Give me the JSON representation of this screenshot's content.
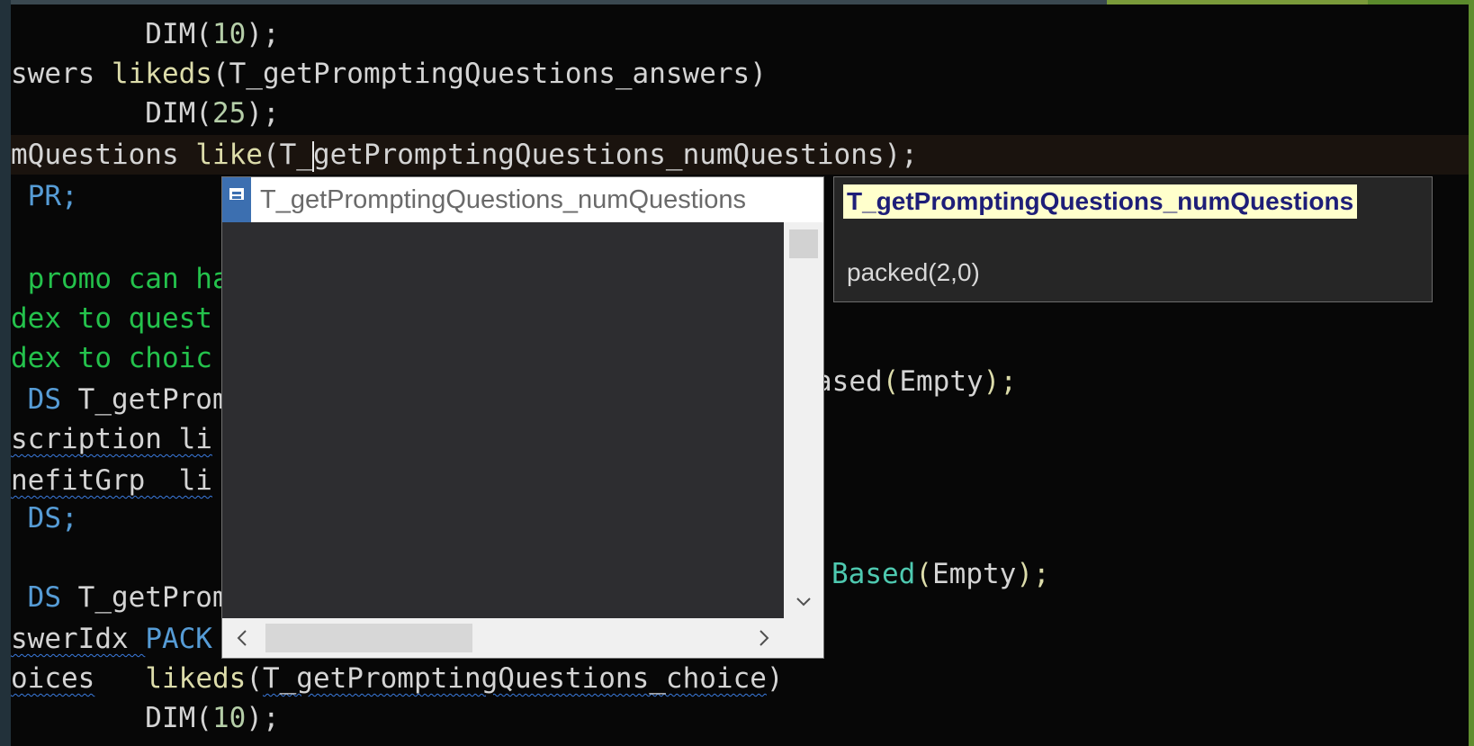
{
  "editor": {
    "lines": [
      {
        "id": "l0",
        "segments": [
          {
            "text": "        DIM(",
            "cls": ""
          },
          {
            "text": "10",
            "cls": "num"
          },
          {
            "text": ");",
            "cls": ""
          }
        ]
      },
      {
        "id": "l1",
        "segments": [
          {
            "text": "swers ",
            "cls": ""
          },
          {
            "text": "likeds",
            "cls": "fn"
          },
          {
            "text": "(T_getPromptingQuestions_answers)",
            "cls": ""
          }
        ]
      },
      {
        "id": "l2",
        "segments": [
          {
            "text": "        DIM(",
            "cls": ""
          },
          {
            "text": "25",
            "cls": "num"
          },
          {
            "text": ");",
            "cls": ""
          }
        ]
      },
      {
        "id": "l3",
        "segments": [
          {
            "text": "mQuestions ",
            "cls": ""
          },
          {
            "text": "like",
            "cls": "fn"
          },
          {
            "text": "(T_",
            "cls": ""
          },
          {
            "text": "",
            "cls": "caret"
          },
          {
            "text": "getPromptingQuestions_numQuestions);",
            "cls": ""
          }
        ]
      },
      {
        "id": "l4",
        "segments": [
          {
            "text": " PR;",
            "cls": "kw"
          }
        ]
      },
      {
        "id": "l5",
        "segments": [
          {
            "text": "",
            "cls": ""
          }
        ]
      },
      {
        "id": "l6",
        "segments": [
          {
            "text": " promo can ha",
            "cls": "cm"
          }
        ]
      },
      {
        "id": "l7",
        "segments": [
          {
            "text": "dex to quest",
            "cls": "cm"
          }
        ]
      },
      {
        "id": "l8",
        "segments": [
          {
            "text": "dex to choic",
            "cls": "cm"
          }
        ]
      },
      {
        "id": "l9",
        "segments": [
          {
            "text": " DS ",
            "cls": "kw"
          },
          {
            "text": "T_getProm",
            "cls": ""
          }
        ]
      },
      {
        "id": "l10",
        "segments": [
          {
            "text": "scription li",
            "cls": "sq"
          }
        ]
      },
      {
        "id": "l11",
        "segments": [
          {
            "text": "nefitGrp  li",
            "cls": "sq"
          }
        ]
      },
      {
        "id": "l12",
        "segments": [
          {
            "text": " DS;",
            "cls": "kw"
          }
        ]
      },
      {
        "id": "l13",
        "segments": [
          {
            "text": "",
            "cls": ""
          }
        ]
      },
      {
        "id": "l14",
        "segments": [
          {
            "text": " DS ",
            "cls": "kw"
          },
          {
            "text": "T_getProm",
            "cls": ""
          }
        ]
      },
      {
        "id": "l15",
        "segments": [
          {
            "text": "swerIdx ",
            "cls": "sq"
          },
          {
            "text": "PACK",
            "cls": "kw"
          }
        ]
      },
      {
        "id": "l16",
        "segments": [
          {
            "text": "oices",
            "cls": "sq"
          },
          {
            "text": "   ",
            "cls": ""
          },
          {
            "text": "likeds",
            "cls": "fn"
          },
          {
            "text": "(",
            "cls": ""
          },
          {
            "text": "T_getPromptingQuestions_choice",
            "cls": "sq"
          },
          {
            "text": ")",
            "cls": ""
          }
        ]
      },
      {
        "id": "l17",
        "segments": [
          {
            "text": "        DIM(",
            "cls": ""
          },
          {
            "text": "10",
            "cls": "num"
          },
          {
            "text": ");",
            "cls": ""
          }
        ]
      }
    ],
    "right_fragments": {
      "line9": {
        "prefix": "ased",
        "paren_open": "(",
        "inner": "Empty",
        "paren_close": ");"
      },
      "line14": {
        "prefix": "Based",
        "paren_open": "(",
        "inner": "Empty",
        "paren_close": ");"
      }
    }
  },
  "autocomplete": {
    "item_label": "T_getPromptingQuestions_numQuestions",
    "item_icon": "field-icon",
    "scroll_down_glyph": "⌄",
    "scroll_left_glyph": "<",
    "scroll_right_glyph": ">"
  },
  "tooltip": {
    "name": "T_getPromptingQuestions_numQuestions",
    "type": "packed(2,0)"
  },
  "colors": {
    "background": "#070707",
    "keyword": "#569cd6",
    "comment": "#24c24c",
    "function": "#dcdcaa",
    "number": "#b5cea8"
  }
}
